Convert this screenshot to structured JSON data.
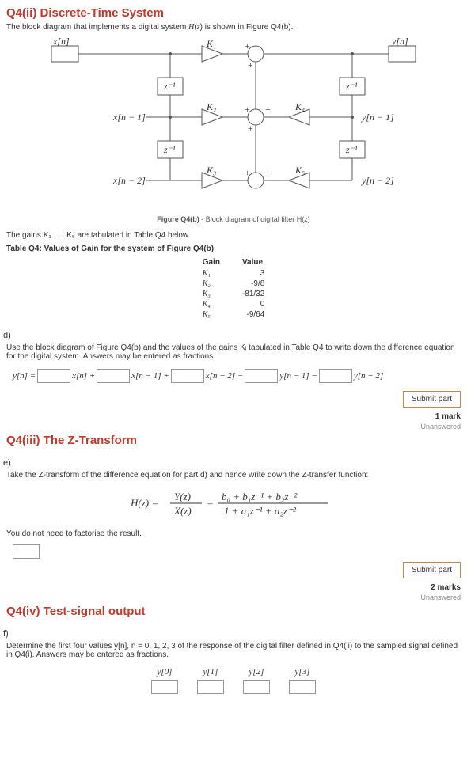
{
  "q4ii": {
    "title": "Q4(ii) Discrete-Time System",
    "intro": "The block diagram that implements a digital system H(z) is shown in Figure Q4(b).",
    "fig_caption_bold": "Figure Q4(b)",
    "fig_caption_rest": " - Block diagram of digital filter H(z)",
    "gains_intro": "The gains K₁ . . . K₅ are tabulated in Table Q4 below.",
    "table_caption": "Table Q4: Values of Gain for the system of Figure Q4(b)",
    "table_headers": {
      "gain": "Gain",
      "value": "Value"
    },
    "table_rows": [
      {
        "gain": "K₁",
        "value": "3"
      },
      {
        "gain": "K₂",
        "value": "-9/8"
      },
      {
        "gain": "K₃",
        "value": "-81/32"
      },
      {
        "gain": "K₄",
        "value": "0"
      },
      {
        "gain": "K₅",
        "value": "-9/64"
      }
    ],
    "diagram": {
      "xn": "x[n]",
      "yn": "y[n]",
      "xn1": "x[n − 1]",
      "yn1": "y[n − 1]",
      "xn2": "x[n − 2]",
      "yn2": "y[n − 2]",
      "zinv": "z⁻¹",
      "k1": "K₁",
      "k2": "K₂",
      "k3": "K₃",
      "k4": "K₄",
      "k5": "K₅"
    }
  },
  "part_d": {
    "label": "d)",
    "question": "Use the block diagram of Figure Q4(b) and the values of the gains Kᵢ tabulated in Table Q4 to write down the difference equation for the digital system. Answers may be entered as fractions.",
    "terms": {
      "yn_eq": "y[n] =",
      "xn": "x[n] +",
      "xn1": "x[n − 1] +",
      "xn2": "x[n − 2] −",
      "yn1": "y[n − 1] −",
      "yn2": "y[n − 2]"
    },
    "submit": "Submit part",
    "marks": "1 mark",
    "status": "Unanswered"
  },
  "q4iii": {
    "title": "Q4(iii) The Z-Transform"
  },
  "part_e": {
    "label": "e)",
    "question": "Take the Z-transform of the difference equation for part d) and hence write down the Z-transfer function:",
    "note": "You do not need to factorise the result.",
    "submit": "Submit part",
    "marks": "2 marks",
    "status": "Unanswered"
  },
  "q4iv": {
    "title": "Q4(iv) Test-signal output"
  },
  "part_f": {
    "label": "f)",
    "question": "Determine the first four values y[n], n = 0, 1, 2, 3 of the response of the digital filter defined in Q4(ii) to the sampled signal defined in Q4(i). Answers may be entered as fractions.",
    "cols": {
      "y0": "y[0]",
      "y1": "y[1]",
      "y2": "y[2]",
      "y3": "y[3]"
    }
  }
}
